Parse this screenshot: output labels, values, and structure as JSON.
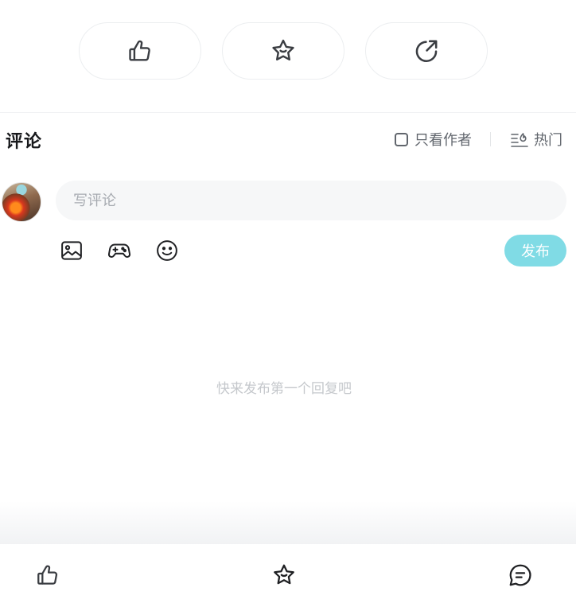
{
  "actions": {
    "like_icon": "thumbs-up-icon",
    "favorite_icon": "star-smile-icon",
    "share_icon": "share-arrow-icon"
  },
  "comments": {
    "title": "评论",
    "only_author_label": "只看作者",
    "sort_label": "热门",
    "input_placeholder": "写评论",
    "publish_label": "发布",
    "empty_text": "快来发布第一个回复吧",
    "tools": [
      "image-icon",
      "gamepad-icon",
      "emoji-icon"
    ]
  },
  "bottom_bar": {
    "items": [
      "thumbs-up-icon",
      "star-smile-icon",
      "chat-bubble-icon"
    ]
  },
  "colors": {
    "accent": "#80dbe5",
    "icon": "#3a3d42",
    "text_muted": "#61666d",
    "placeholder": "#a7abb1",
    "input_bg": "#f6f7f8"
  }
}
